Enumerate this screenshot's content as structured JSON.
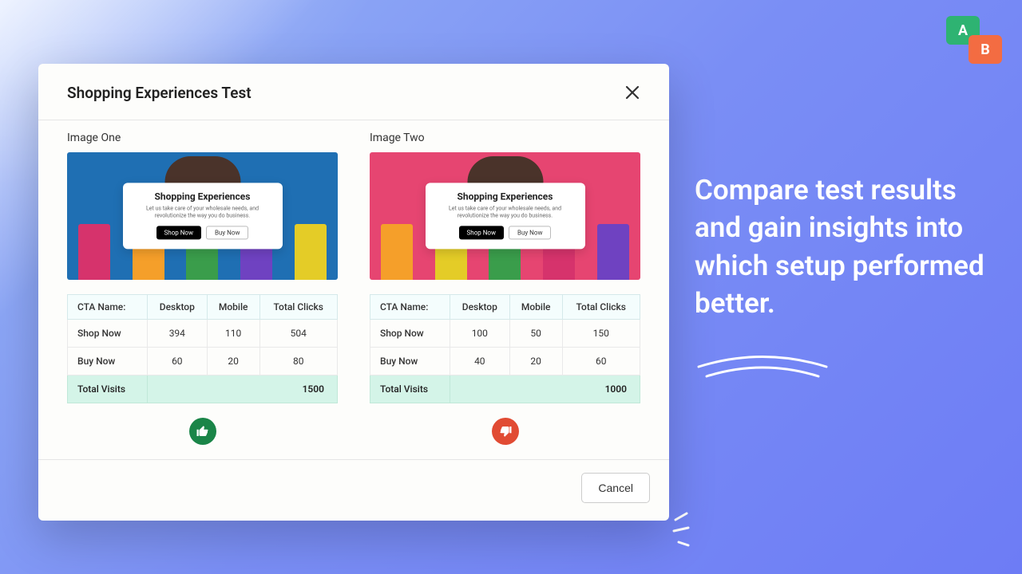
{
  "promo": {
    "text": "Compare test results and gain insights into which setup performed better."
  },
  "ab_badge": {
    "a": "A",
    "b": "B"
  },
  "modal": {
    "title": "Shopping Experiences Test",
    "variant_one_label": "Image One",
    "variant_two_label": "Image Two",
    "popup": {
      "heading": "Shopping Experiences",
      "sub": "Let us take care of your wholesale needs, and revolutionize the way you do business.",
      "shop_now": "Shop Now",
      "buy_now": "Buy Now"
    },
    "table_headers": {
      "cta": "CTA Name:",
      "desktop": "Desktop",
      "mobile": "Mobile",
      "total": "Total Clicks"
    },
    "variant_one_rows": [
      {
        "cta": "Shop Now",
        "desktop": "394",
        "mobile": "110",
        "total": "504"
      },
      {
        "cta": "Buy Now",
        "desktop": "60",
        "mobile": "20",
        "total": "80"
      }
    ],
    "variant_two_rows": [
      {
        "cta": "Shop Now",
        "desktop": "100",
        "mobile": "50",
        "total": "150"
      },
      {
        "cta": "Buy Now",
        "desktop": "40",
        "mobile": "20",
        "total": "60"
      }
    ],
    "total_visits_label": "Total Visits",
    "variant_one_visits": "1500",
    "variant_two_visits": "1000",
    "cancel": "Cancel"
  },
  "chart_data": {
    "type": "table",
    "title": "Shopping Experiences Test — CTA click comparison",
    "variants": [
      {
        "name": "Image One",
        "total_visits": 1500,
        "rows": [
          {
            "cta": "Shop Now",
            "desktop": 394,
            "mobile": 110,
            "total_clicks": 504
          },
          {
            "cta": "Buy Now",
            "desktop": 60,
            "mobile": 20,
            "total_clicks": 80
          }
        ],
        "verdict": "winner"
      },
      {
        "name": "Image Two",
        "total_visits": 1000,
        "rows": [
          {
            "cta": "Shop Now",
            "desktop": 100,
            "mobile": 50,
            "total_clicks": 150
          },
          {
            "cta": "Buy Now",
            "desktop": 40,
            "mobile": 20,
            "total_clicks": 60
          }
        ],
        "verdict": "loser"
      }
    ]
  }
}
